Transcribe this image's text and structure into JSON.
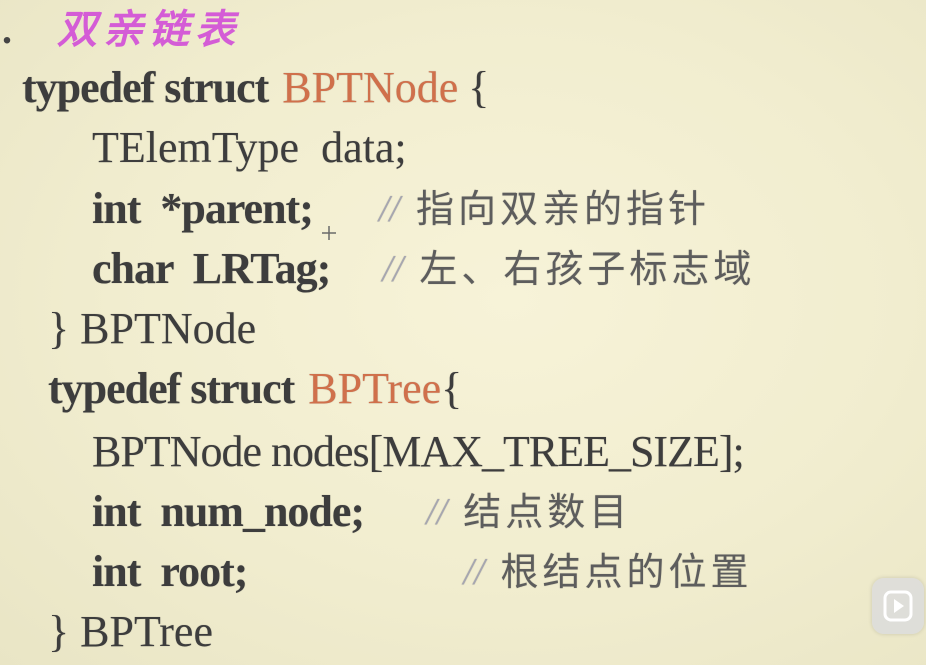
{
  "heading": {
    "bullet": ".",
    "title": "双亲链表"
  },
  "code": {
    "line1": {
      "kw": "typedef struct",
      "name": "BPTNode",
      "brace": "{"
    },
    "line2": {
      "text": "TElemType  data;"
    },
    "line3": {
      "code": "int  *parent;",
      "slashes": "//",
      "comment": "指向双亲的指针"
    },
    "line4": {
      "code": "char  LRTag;",
      "slashes": "//",
      "comment": "左、右孩子标志域"
    },
    "line5": {
      "text": "} BPTNode"
    },
    "line6": {
      "kw": "typedef struct",
      "name": "BPTree",
      "brace": "{"
    },
    "line7": {
      "text": "BPTNode nodes[MAX_TREE_SIZE];"
    },
    "line8": {
      "code": "int  num_node;",
      "slashes": "//",
      "comment": "结点数目"
    },
    "line9": {
      "code": "int  root;",
      "slashes": "//",
      "comment": "根结点的位置"
    },
    "line10": {
      "text": "} BPTree"
    }
  },
  "colors": {
    "title": "#d45cd6",
    "type_name": "#d0704b",
    "background": "#f1edcf"
  },
  "controls": {
    "play_icon": "play-icon"
  }
}
